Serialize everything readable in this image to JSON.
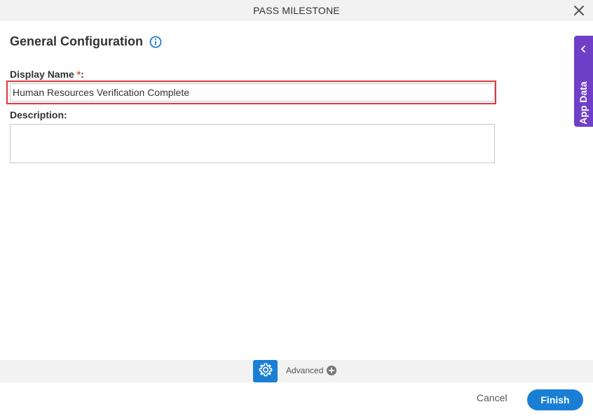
{
  "dialog": {
    "title": "PASS MILESTONE"
  },
  "section": {
    "title": "General Configuration",
    "info_icon": "info-circle-icon"
  },
  "form": {
    "display_name_label": "Display Name ",
    "required_marker": "*",
    "label_suffix": ":",
    "display_name_value": "Human Resources Verification Complete",
    "description_label": "Description:",
    "description_value": ""
  },
  "side_panel": {
    "label": "App Data",
    "icon": "chevron-left-icon",
    "color": "#6f3fc7"
  },
  "advanced": {
    "label": "Advanced",
    "gear_icon": "gear-icon",
    "plus_icon": "plus-circle-icon"
  },
  "footer": {
    "cancel_label": "Cancel",
    "finish_label": "Finish"
  },
  "colors": {
    "accent": "#1a7fd4",
    "highlight_border": "#e0393e",
    "required": "#e05a2a"
  }
}
